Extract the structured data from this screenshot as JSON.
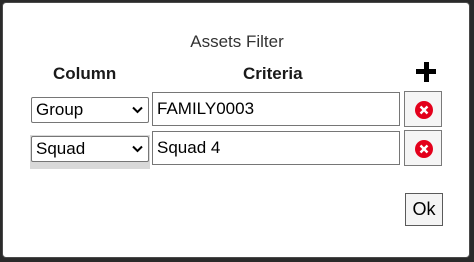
{
  "dialog": {
    "title": "Assets Filter",
    "headers": {
      "column": "Column",
      "criteria": "Criteria"
    },
    "add_icon": "plus-icon",
    "remove_icon": "x-circle-icon",
    "remove_color": "#e3001b",
    "rows": [
      {
        "column": "Group",
        "criteria": "FAMILY0003"
      },
      {
        "column": "Squad",
        "criteria": "Squad 4"
      }
    ],
    "ok_label": "Ok"
  }
}
